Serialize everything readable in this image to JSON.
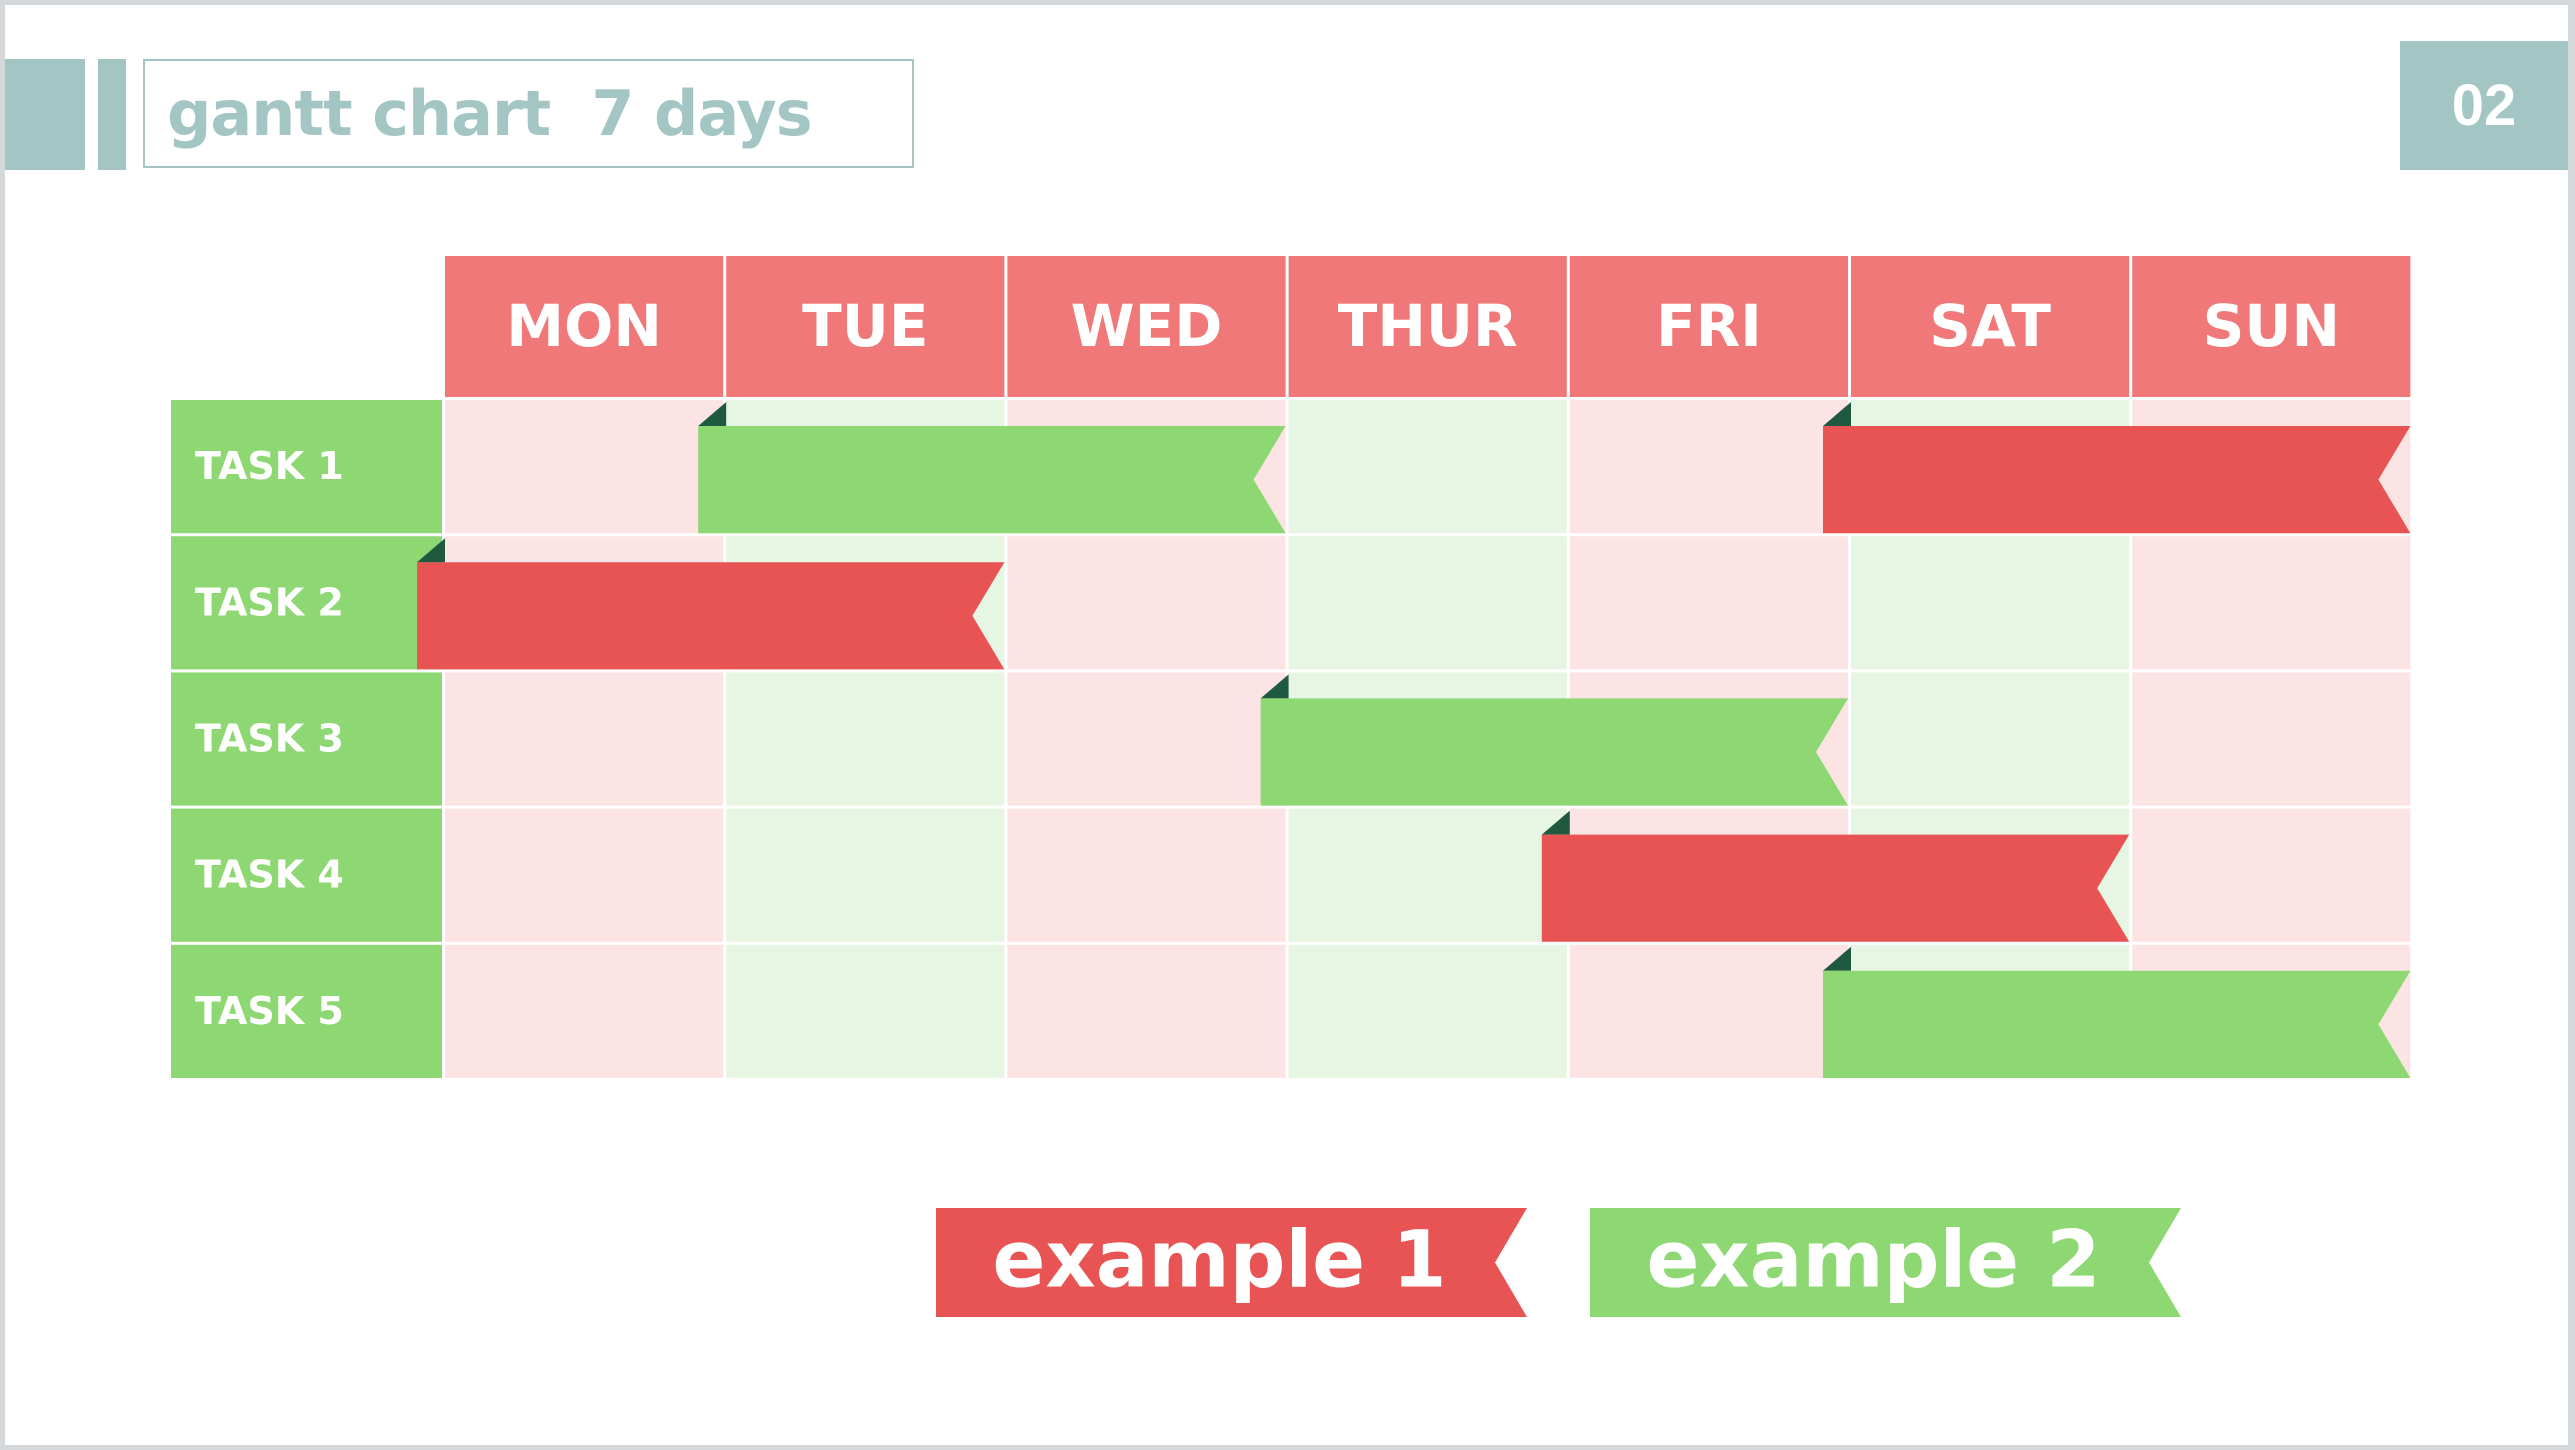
{
  "slide": {
    "title": "gantt chart  7 days",
    "page_number": "02"
  },
  "colors": {
    "accent_teal": "#a3c6c4",
    "header_red": "#f07878",
    "task_green": "#8dd873",
    "bar_red": "#e85454",
    "bar_green": "#8dd873",
    "cell_pink": "#fbe4e3",
    "cell_green": "#e6f6e2",
    "fold_dark": "#1f5a40"
  },
  "chart_data": {
    "type": "gantt",
    "title": "gantt chart  7 days",
    "categories": [
      "MON",
      "TUE",
      "WED",
      "THUR",
      "FRI",
      "SAT",
      "SUN"
    ],
    "tasks": [
      "TASK 1",
      "TASK 2",
      "TASK 3",
      "TASK 4",
      "TASK 5"
    ],
    "bars": [
      {
        "task": "TASK 1",
        "start_day": "TUE",
        "end_day": "WED",
        "series": "example 2"
      },
      {
        "task": "TASK 1",
        "start_day": "SAT",
        "end_day": "SUN",
        "series": "example 1"
      },
      {
        "task": "TASK 2",
        "start_day": "MON",
        "end_day": "TUE",
        "series": "example 1"
      },
      {
        "task": "TASK 3",
        "start_day": "THUR",
        "end_day": "FRI",
        "series": "example 2"
      },
      {
        "task": "TASK 4",
        "start_day": "FRI",
        "end_day": "SAT",
        "series": "example 1"
      },
      {
        "task": "TASK 5",
        "start_day": "SAT",
        "end_day": "SUN",
        "series": "example 2"
      }
    ],
    "legend": [
      {
        "label": "example 1",
        "color": "#e85454"
      },
      {
        "label": "example 2",
        "color": "#8dd873"
      }
    ],
    "legend_position": "bottom-center"
  }
}
